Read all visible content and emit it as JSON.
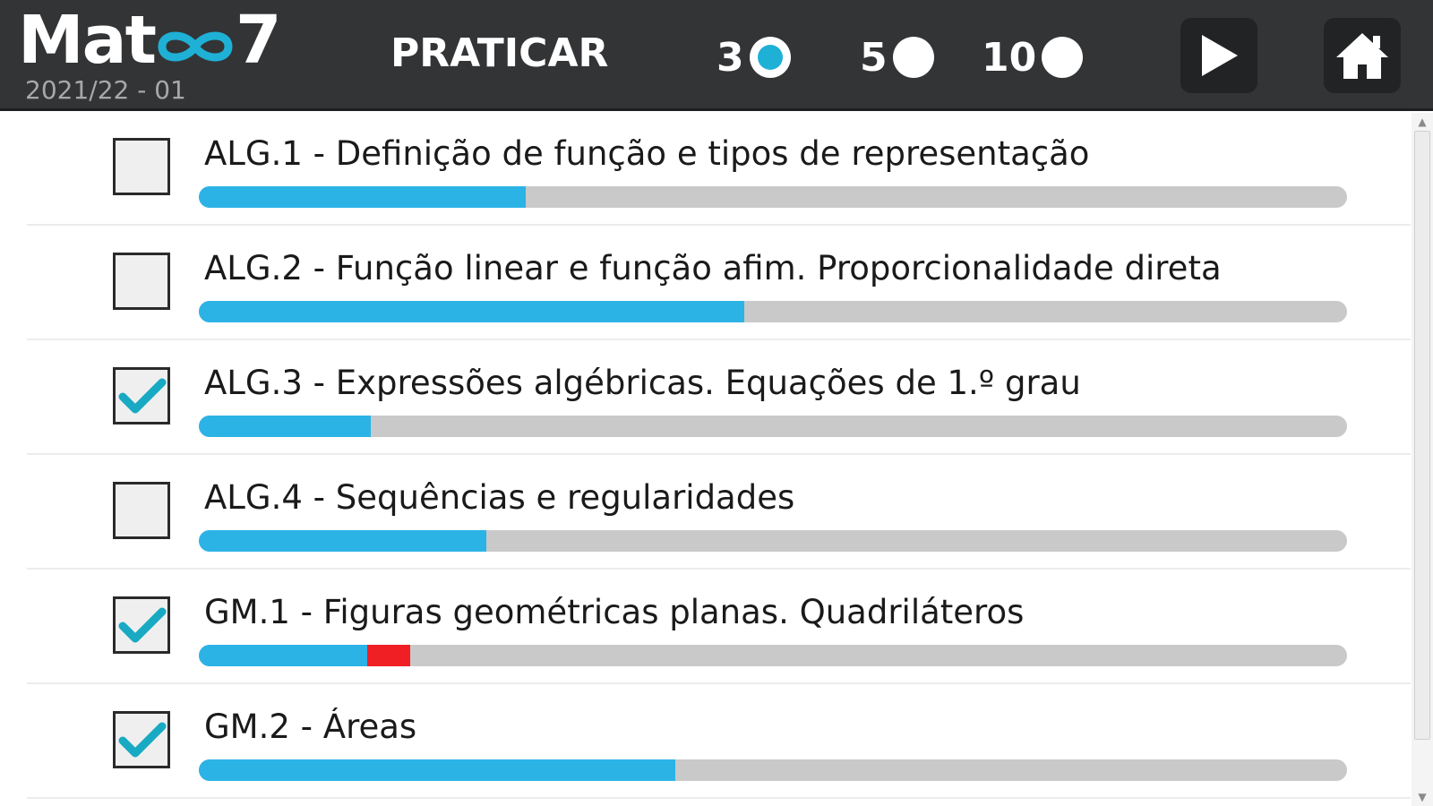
{
  "header": {
    "logo_left": "Mat",
    "logo_right": "7",
    "version": "2021/22 - 01",
    "mode_title": "PRATICAR",
    "counts": [
      {
        "label": "3",
        "selected": true
      },
      {
        "label": "5",
        "selected": false
      },
      {
        "label": "10",
        "selected": false
      }
    ],
    "play_icon": "play-icon",
    "home_icon": "home-icon"
  },
  "colors": {
    "header_bg": "#333436",
    "accent": "#1fb0d6",
    "progress_fill": "#2cb3e6",
    "progress_track": "#c9c9c9",
    "progress_error": "#f01f24",
    "check": "#18a9c3"
  },
  "topics": [
    {
      "label": "ALG.1 - Definição de função e tipos de representação",
      "checked": false,
      "progress": 0.285,
      "error": 0
    },
    {
      "label": "ALG.2 - Função linear e função afim. Proporcionalidade direta",
      "checked": false,
      "progress": 0.475,
      "error": 0
    },
    {
      "label": "ALG.3 - Expressões algébricas. Equações de 1.º grau",
      "checked": true,
      "progress": 0.15,
      "error": 0
    },
    {
      "label": "ALG.4 - Sequências e regularidades",
      "checked": false,
      "progress": 0.25,
      "error": 0
    },
    {
      "label": "GM.1 - Figuras geométricas planas. Quadriláteros",
      "checked": true,
      "progress": 0.147,
      "error": 0.037
    },
    {
      "label": "GM.2 - Áreas",
      "checked": true,
      "progress": 0.415,
      "error": 0
    }
  ]
}
